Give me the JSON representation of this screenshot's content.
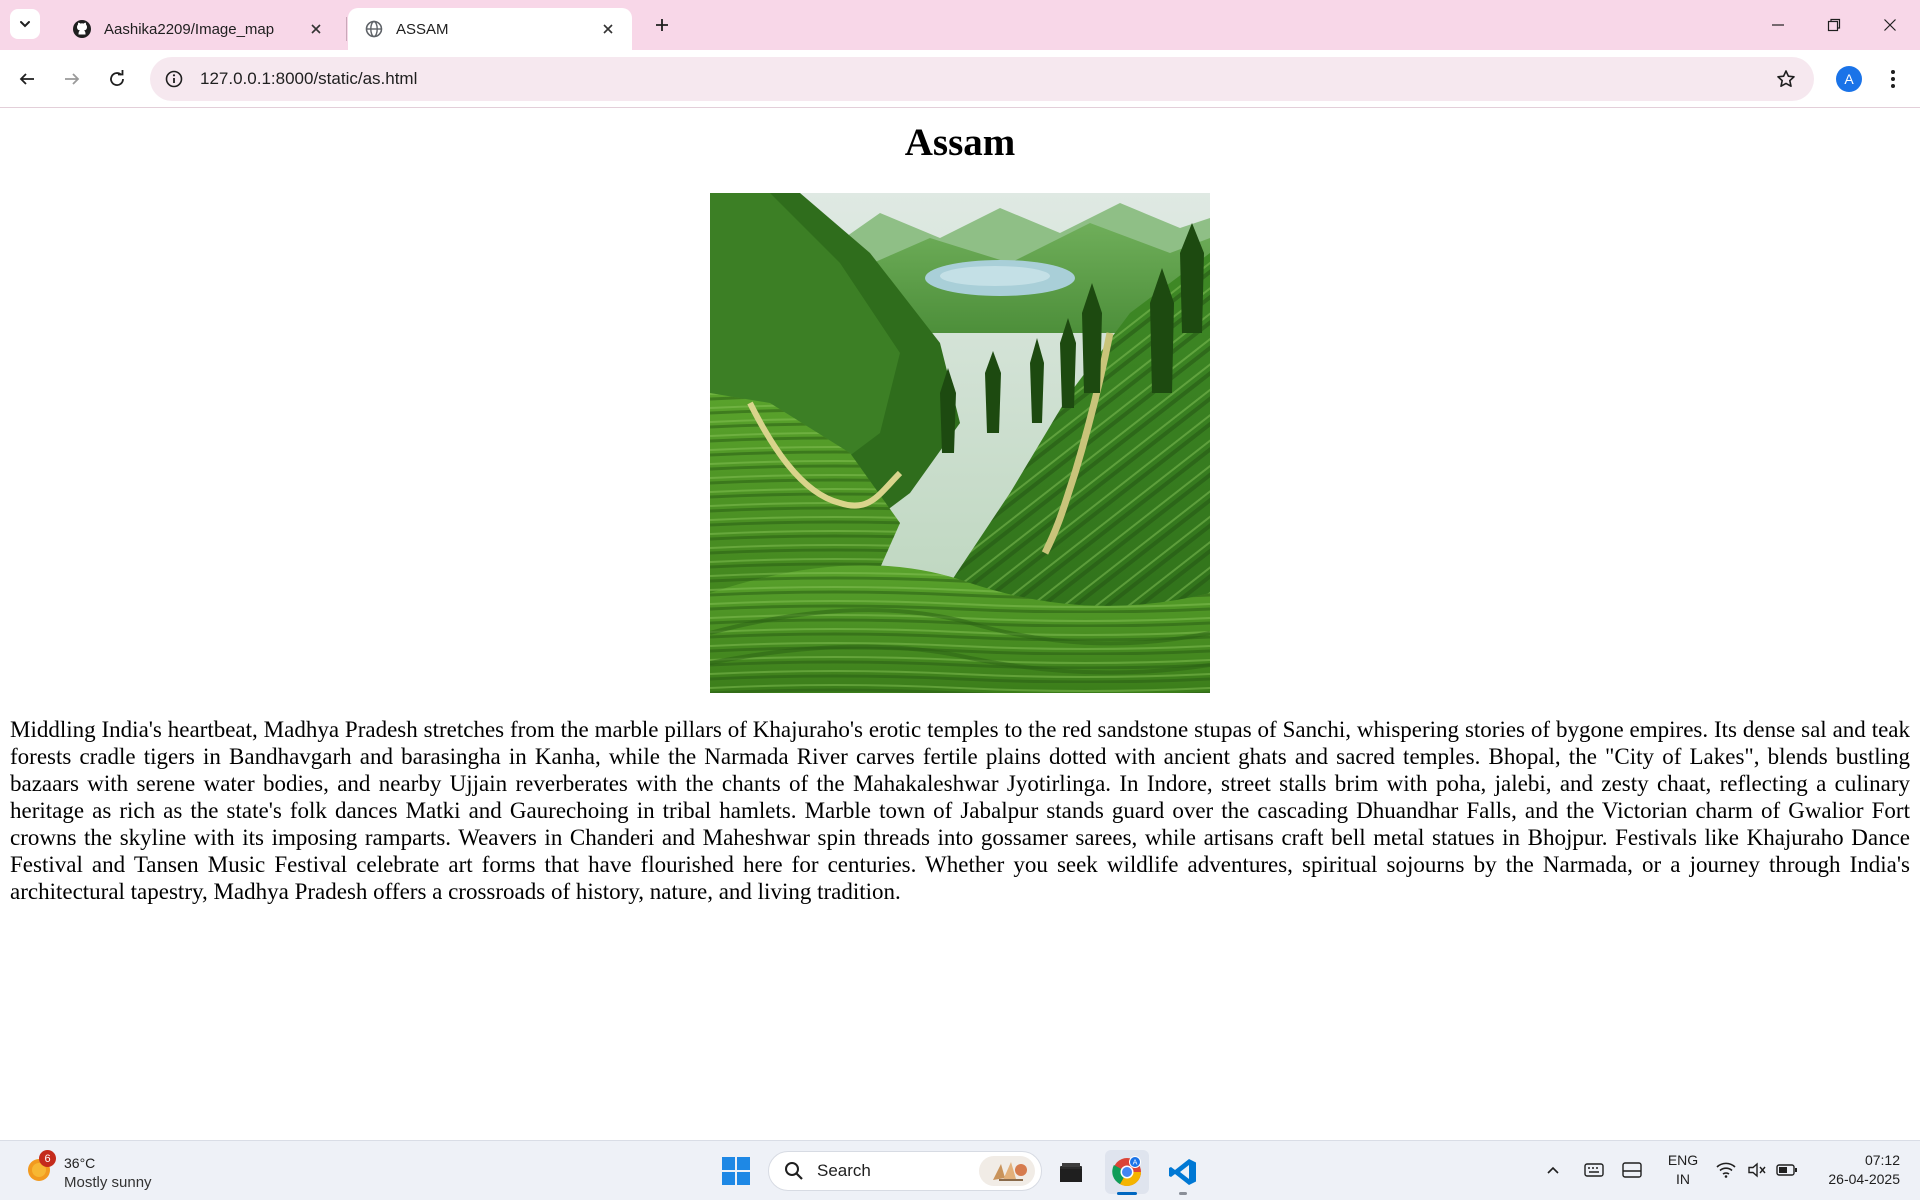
{
  "browser": {
    "tabs": [
      {
        "title": "Aashika2209/Image_map",
        "icon": "github-icon",
        "active": false
      },
      {
        "title": "ASSAM",
        "icon": "globe-icon",
        "active": true
      }
    ],
    "url": "127.0.0.1:8000/static/as.html",
    "profile_initial": "A",
    "theme_color": "#f8d7e8"
  },
  "page": {
    "heading": "Assam",
    "image_alt": "Green tea plantation terraces on hills with a lake in the valley",
    "paragraph": "Middling India's heartbeat, Madhya Pradesh stretches from the marble pillars of Khajuraho's erotic temples to the red sandstone stupas of Sanchi, whispering stories of bygone empires. Its dense sal and teak forests cradle tigers in Bandhavgarh and barasingha in Kanha, while the Narmada River carves fertile plains dotted with ancient ghats and sacred temples. Bhopal, the \"City of Lakes\", blends bustling bazaars with serene water bodies, and nearby Ujjain reverberates with the chants of the Mahakaleshwar Jyotirlinga. In Indore, street stalls brim with poha, jalebi, and zesty chaat, reflecting a culinary heritage as rich as the state's folk dances Matki and Gaurechoing in tribal hamlets. Marble town of Jabalpur stands guard over the cascading Dhuandhar Falls, and the Victorian charm of Gwalior Fort crowns the skyline with its imposing ramparts. Weavers in Chanderi and Maheshwar spin threads into gossamer sarees, while artisans craft bell metal statues in Bhojpur. Festivals like Khajuraho Dance Festival and Tansen Music Festival celebrate art forms that have flourished here for centuries. Whether you seek wildlife adventures, spiritual sojourns by the Narmada, or a journey through India's architectural tapestry, Madhya Pradesh offers a crossroads of history, nature, and living tradition."
  },
  "taskbar": {
    "weather": {
      "badge": "6",
      "temp": "36°C",
      "condition": "Mostly sunny"
    },
    "search_label": "Search",
    "apps": [
      "file-explorer-icon",
      "chrome-icon",
      "vscode-icon"
    ],
    "language": {
      "line1": "ENG",
      "line2": "IN"
    },
    "clock": {
      "time": "07:12",
      "date": "26-04-2025"
    }
  }
}
